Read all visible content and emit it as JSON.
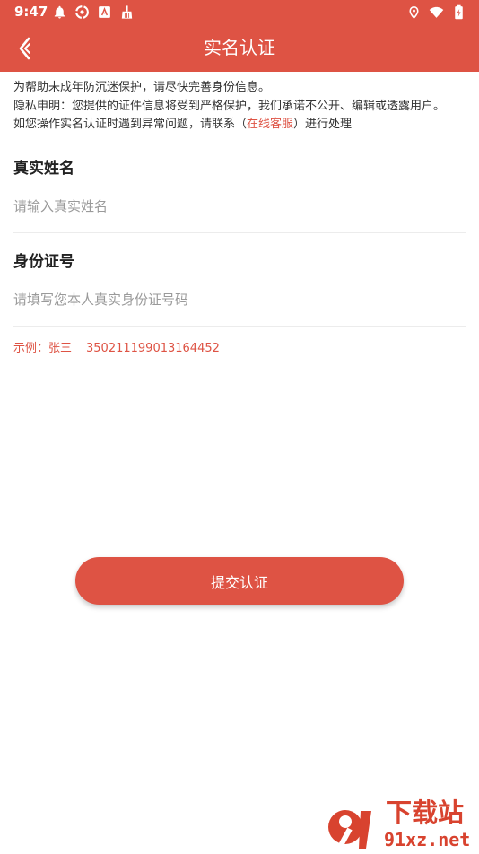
{
  "status_bar": {
    "time": "9:47",
    "left_icons": [
      "bell-icon",
      "sync-icon",
      "font-a-icon",
      "broom-icon"
    ],
    "right_icons": [
      "location-pin-icon",
      "wifi-icon",
      "battery-icon"
    ]
  },
  "header": {
    "title": "实名认证",
    "back_icon": "chevron-left-icon",
    "background": "#de5344"
  },
  "notice": {
    "line1": "为帮助未成年防沉迷保护，请尽快完善身份信息。",
    "line2": "隐私申明：您提供的证件信息将受到严格保护，我们承诺不公开、编辑或透露用户。",
    "line3_prefix": "如您操作实名认证时遇到异常问题，请联系（",
    "line3_link": "在线客服",
    "line3_suffix": "）进行处理"
  },
  "form": {
    "name_label": "真实姓名",
    "name_value": "",
    "name_placeholder": "请输入真实姓名",
    "id_label": "身份证号",
    "id_value": "",
    "id_placeholder": "请填写您本人真实身份证号码",
    "example_label": "示例：张三",
    "example_number": "350211199013164452"
  },
  "submit": {
    "label": "提交认证"
  },
  "watermark": {
    "title": "下载站",
    "url": "91xz.net",
    "logo_text": "91"
  },
  "colors": {
    "accent": "#de5344",
    "text": "#222222",
    "placeholder": "#9a9a9a"
  }
}
